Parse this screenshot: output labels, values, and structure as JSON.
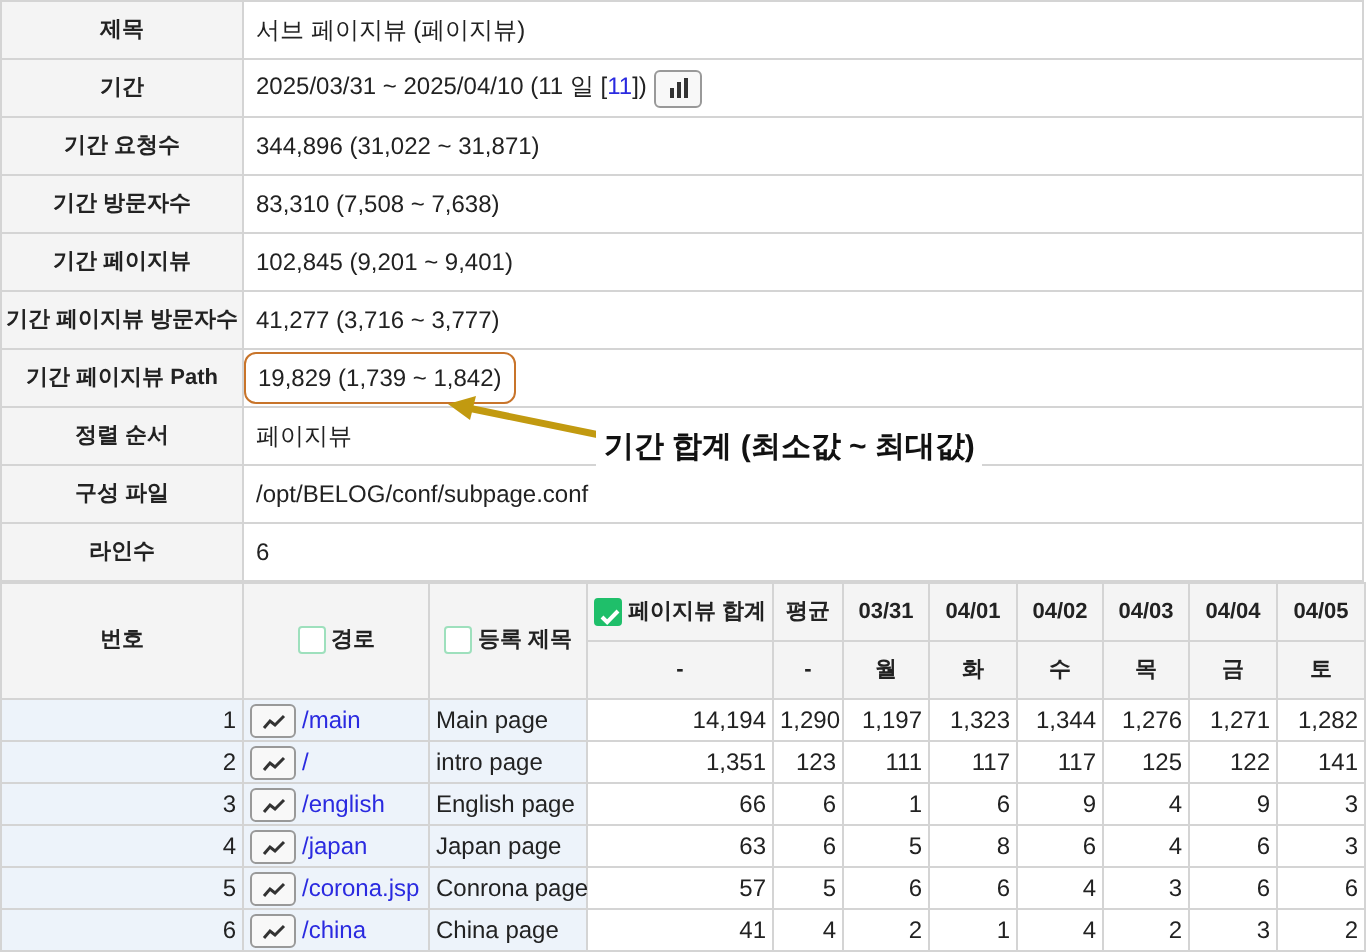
{
  "info": [
    {
      "label": "제목",
      "value": "서브 페이지뷰 (페이지뷰)",
      "highlighted": false
    },
    {
      "label": "기간",
      "value": "2025/03/31 ~ 2025/04/10 (11 일 [",
      "link": "11",
      "value_end": "])",
      "chart_button": true,
      "highlighted": false
    },
    {
      "label": "기간 요청수",
      "value": "344,896 (31,022 ~ 31,871)",
      "highlighted": false
    },
    {
      "label": "기간 방문자수",
      "value": "83,310 (7,508 ~ 7,638)",
      "highlighted": false
    },
    {
      "label": "기간 페이지뷰",
      "value": "102,845 (9,201 ~ 9,401)",
      "highlighted": false
    },
    {
      "label": "기간 페이지뷰 방문자수",
      "value": "41,277 (3,716 ~ 3,777)",
      "highlighted": false
    },
    {
      "label": "기간 페이지뷰 Path",
      "value": "19,829 (1,739 ~ 1,842)",
      "highlighted": true
    },
    {
      "label": "정렬 순서",
      "value": "페이지뷰",
      "highlighted": false
    },
    {
      "label": "구성 파일",
      "value": "/opt/BELOG/conf/subpage.conf",
      "highlighted": false
    },
    {
      "label": "라인수",
      "value": "6",
      "highlighted": false
    }
  ],
  "annotation": {
    "text": "기간 합계 (최소값 ~ 최대값)"
  },
  "table": {
    "columns": [
      {
        "kind": "plain",
        "label": "번호"
      },
      {
        "kind": "checkbox",
        "label": "경로",
        "checked": false
      },
      {
        "kind": "checkbox",
        "label": "등록 제목",
        "checked": false
      },
      {
        "kind": "checkbox",
        "label": "페이지뷰 합계",
        "checked": true,
        "sub": "-"
      },
      {
        "kind": "plain",
        "label": "평균",
        "sub": "-"
      },
      {
        "kind": "plain",
        "label": "03/31",
        "sub": "월"
      },
      {
        "kind": "plain",
        "label": "04/01",
        "sub": "화"
      },
      {
        "kind": "plain",
        "label": "04/02",
        "sub": "수"
      },
      {
        "kind": "plain",
        "label": "04/03",
        "sub": "목"
      },
      {
        "kind": "plain",
        "label": "04/04",
        "sub": "금"
      },
      {
        "kind": "plain",
        "label": "04/05",
        "sub": "토"
      }
    ],
    "rows": [
      {
        "number": "1",
        "path": "/main",
        "title": "Main page",
        "values": [
          "14,194",
          "1,290",
          "1,197",
          "1,323",
          "1,344",
          "1,276",
          "1,271",
          "1,282"
        ]
      },
      {
        "number": "2",
        "path": "/",
        "title": "intro page",
        "values": [
          "1,351",
          "123",
          "111",
          "117",
          "117",
          "125",
          "122",
          "141"
        ]
      },
      {
        "number": "3",
        "path": "/english",
        "title": "English page",
        "values": [
          "66",
          "6",
          "1",
          "6",
          "9",
          "4",
          "9",
          "3"
        ]
      },
      {
        "number": "4",
        "path": "/japan",
        "title": "Japan page",
        "values": [
          "63",
          "6",
          "5",
          "8",
          "6",
          "4",
          "6",
          "3"
        ]
      },
      {
        "number": "5",
        "path": "/corona.jsp",
        "title": "Conrona page",
        "values": [
          "57",
          "5",
          "6",
          "6",
          "4",
          "3",
          "6",
          "6"
        ]
      },
      {
        "number": "6",
        "path": "/china",
        "title": "China page",
        "values": [
          "41",
          "4",
          "2",
          "1",
          "4",
          "2",
          "3",
          "2"
        ]
      }
    ]
  }
}
